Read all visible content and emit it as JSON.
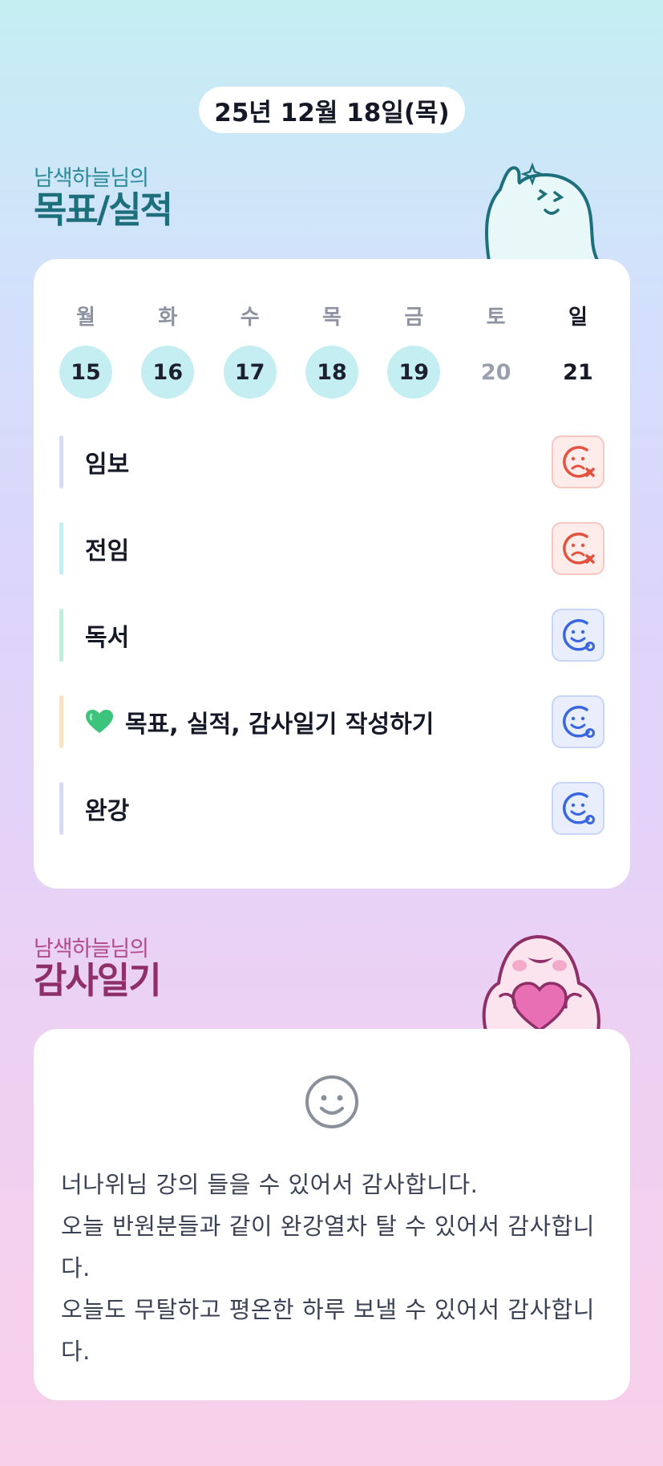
{
  "header": {
    "date": "25년 12월 18일(목)"
  },
  "goal_section": {
    "title_small": "남색하늘님의",
    "title_big": "목표/실적",
    "weekdays": [
      "월",
      "화",
      "수",
      "목",
      "금",
      "토",
      "일"
    ],
    "dates": [
      "15",
      "16",
      "17",
      "18",
      "19",
      "20",
      "21"
    ],
    "completed_days": [
      "15",
      "16",
      "17",
      "18",
      "19"
    ],
    "goals": [
      {
        "label": "임보",
        "status": "fail",
        "bar_color": "#d6dcf7",
        "status_icon": "sad-x-icon"
      },
      {
        "label": "전임",
        "status": "fail",
        "bar_color": "#c8eef3",
        "status_icon": "sad-x-icon"
      },
      {
        "label": "독서",
        "status": "ok",
        "bar_color": "#c3ecd9",
        "status_icon": "smile-o-icon"
      },
      {
        "label": "목표, 실적, 감사일기 작성하기",
        "status": "ok",
        "bar_color": "#fbe1c6",
        "status_icon": "smile-o-icon",
        "emoji": "green-heart-icon"
      },
      {
        "label": "완강",
        "status": "ok",
        "bar_color": "#d6dcf7",
        "status_icon": "smile-o-icon"
      }
    ]
  },
  "gratitude_section": {
    "title_small": "남색하늘님의",
    "title_big": "감사일기",
    "mood_icon": "smile-face-icon",
    "lines": [
      "너나위님 강의 들을 수 있어서 감사합니다.",
      "오늘 반원분들과 같이 완강열차 탈 수 있어서 감사합니다.",
      "오늘도 무탈하고 평온한 하루 보낼 수 있어서 감사합니다."
    ]
  },
  "colors": {
    "fail": "#e2523f",
    "ok": "#3a66e0",
    "goal_title": "#1d6f7c",
    "gratitude_title": "#8f2f67"
  }
}
